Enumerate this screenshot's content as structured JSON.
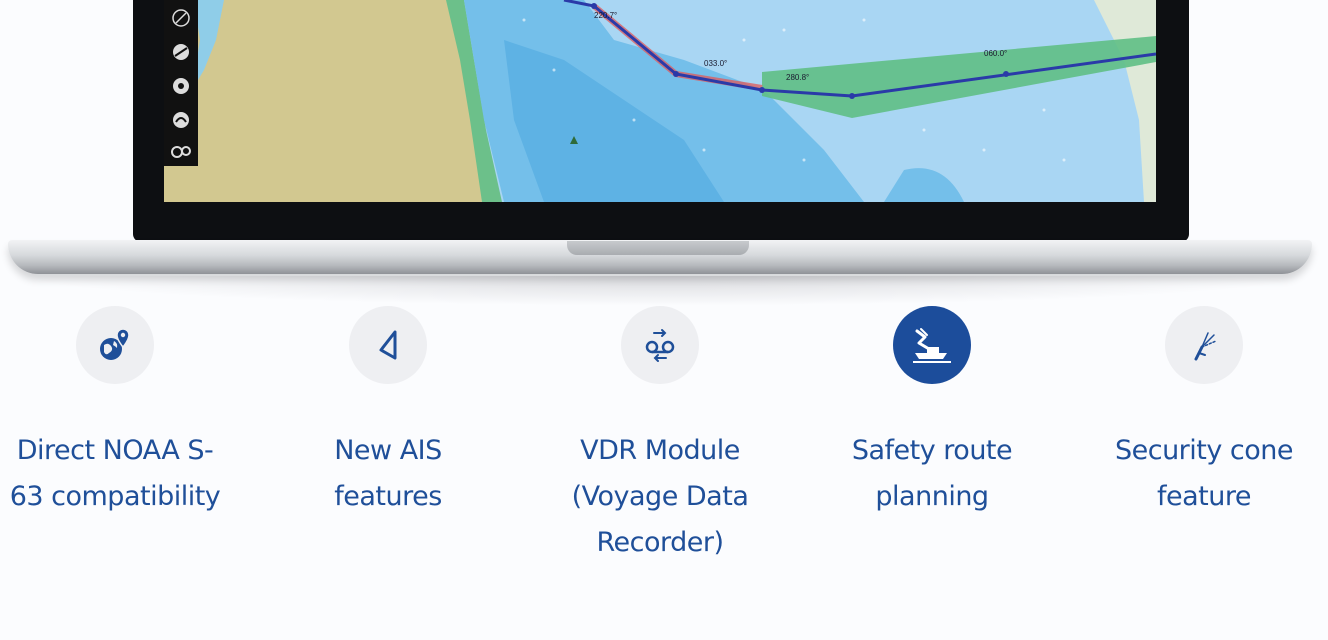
{
  "chart_screen": {
    "route_labels": [
      "033.0°",
      "280.8°",
      "060.0°",
      "220.7°"
    ],
    "colors": {
      "water_light": "#a9d6f3",
      "water_mid": "#74bfea",
      "land": "#d2c890",
      "shallow_green": "#6cc08a",
      "route_line": "#2a3aa8",
      "route_highlight": "#e25858"
    }
  },
  "toolbar": {
    "icons": [
      "compass-icon",
      "satellite-icon",
      "target-icon",
      "satellite-dish-icon",
      "settings-group-icon"
    ]
  },
  "features": [
    {
      "icon": "globe-pin-icon",
      "active": false,
      "lines": [
        "Direct NOAA S-",
        "63 compatibility"
      ]
    },
    {
      "icon": "ais-triangle-icon",
      "active": false,
      "lines": [
        "New AIS",
        "features"
      ]
    },
    {
      "icon": "tape-recorder-icon",
      "active": false,
      "lines": [
        "VDR Module",
        "(Voyage Data",
        "Recorder)"
      ]
    },
    {
      "icon": "safety-route-icon",
      "active": true,
      "lines": [
        "Safety route",
        "planning"
      ]
    },
    {
      "icon": "security-cone-icon",
      "active": false,
      "lines": [
        "Security cone",
        "feature"
      ]
    }
  ],
  "colors": {
    "label_blue": "#1f4f99",
    "icon_bg": "#eeeff2",
    "icon_active_bg": "#1c4d9b"
  }
}
